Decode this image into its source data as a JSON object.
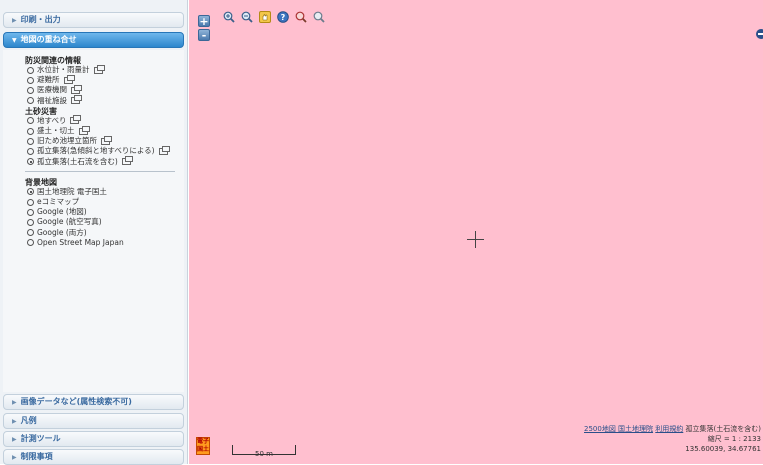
{
  "sidebar": {
    "sections": [
      {
        "label": "印刷・出力",
        "expanded": false
      },
      {
        "label": "地図の重ね合せ",
        "expanded": true
      },
      {
        "label": "画像データなど(属性検索不可)",
        "expanded": false
      },
      {
        "label": "凡例",
        "expanded": false
      },
      {
        "label": "計測ツール",
        "expanded": false
      },
      {
        "label": "制限事項",
        "expanded": false
      }
    ],
    "disaster_group": {
      "title": "防災関連の情報",
      "items": [
        "水位計・雨量計",
        "避難所",
        "医療機関",
        "福祉施設"
      ]
    },
    "landslide_group": {
      "title": "土砂災害",
      "items": [
        "地すべり",
        "盛土・切土",
        "旧ため池埋立箇所",
        "孤立集落(急傾斜と地すべりによる)",
        "孤立集落(土石流を含む)"
      ],
      "selected": "孤立集落(土石流を含む)"
    },
    "basemap_group": {
      "title": "背景地図",
      "items": [
        "国土地理院 電子国土",
        "eコミマップ",
        "Google (地図)",
        "Google (航空写真)",
        "Google (両方)",
        "Open Street Map Japan"
      ],
      "selected": "国土地理院 電子国土"
    }
  },
  "map": {
    "background_color": "#ffbfcf",
    "zoom_in_label": "+",
    "zoom_out_label": "-",
    "tools": [
      "zoom-in-icon",
      "zoom-out-icon",
      "pan-hand-icon",
      "help-icon",
      "search-icon",
      "measure-icon"
    ],
    "logo_text": "電子国土",
    "scale_label": "50 m",
    "attribution": {
      "link1": "2500地図 国土地理院",
      "link2": "利用規約",
      "layer": "孤立集落(土石流を含む)",
      "scale": "縮尺 = 1 : 2133",
      "coords": "135.60039, 34.67761"
    }
  }
}
